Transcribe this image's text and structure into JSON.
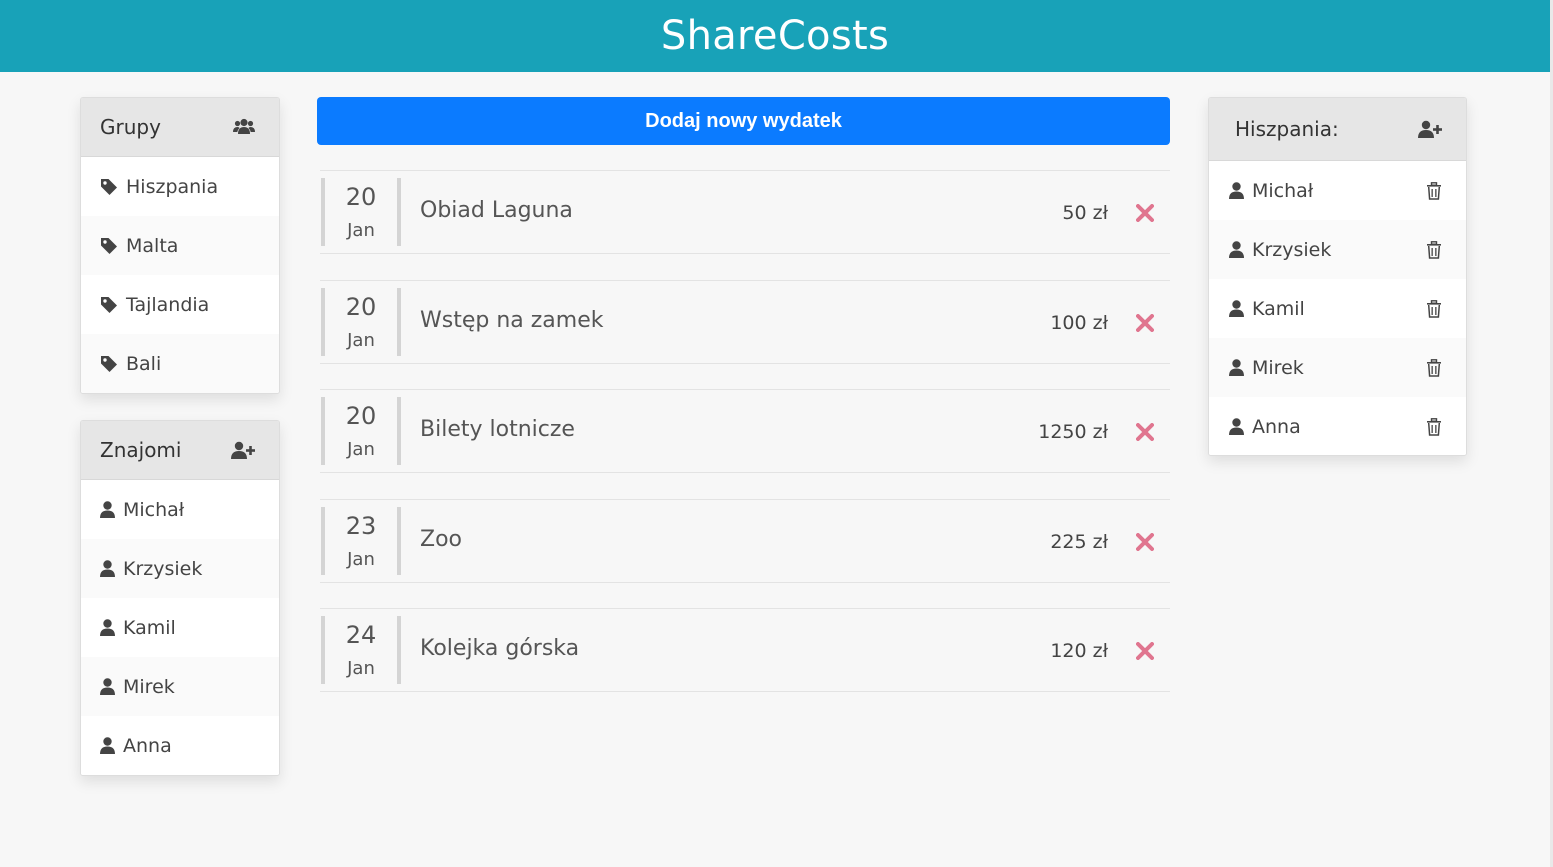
{
  "app": {
    "title": "ShareCosts"
  },
  "groups": {
    "title": "Grupy",
    "items": [
      {
        "label": "Hiszpania"
      },
      {
        "label": "Malta"
      },
      {
        "label": "Tajlandia"
      },
      {
        "label": "Bali"
      }
    ]
  },
  "friends": {
    "title": "Znajomi",
    "items": [
      {
        "label": "Michał"
      },
      {
        "label": "Krzysiek"
      },
      {
        "label": "Kamil"
      },
      {
        "label": "Mirek"
      },
      {
        "label": "Anna"
      }
    ]
  },
  "add_button": {
    "label": "Dodaj nowy wydatek"
  },
  "expenses": [
    {
      "day": "20",
      "month": "Jan",
      "name": "Obiad Laguna",
      "amount": "50 zł"
    },
    {
      "day": "20",
      "month": "Jan",
      "name": "Wstęp na zamek",
      "amount": "100 zł"
    },
    {
      "day": "20",
      "month": "Jan",
      "name": "Bilety lotnicze",
      "amount": "1250 zł"
    },
    {
      "day": "23",
      "month": "Jan",
      "name": "Zoo",
      "amount": "225 zł"
    },
    {
      "day": "24",
      "month": "Jan",
      "name": "Kolejka górska",
      "amount": "120 zł"
    }
  ],
  "members": {
    "title": "Hiszpania:",
    "items": [
      {
        "label": "Michał"
      },
      {
        "label": "Krzysiek"
      },
      {
        "label": "Kamil"
      },
      {
        "label": "Mirek"
      },
      {
        "label": "Anna"
      }
    ]
  },
  "colors": {
    "header": "#18a2b8",
    "primary_button": "#0b7bff",
    "delete_icon": "#e0758f",
    "icon_dark": "#444444"
  }
}
